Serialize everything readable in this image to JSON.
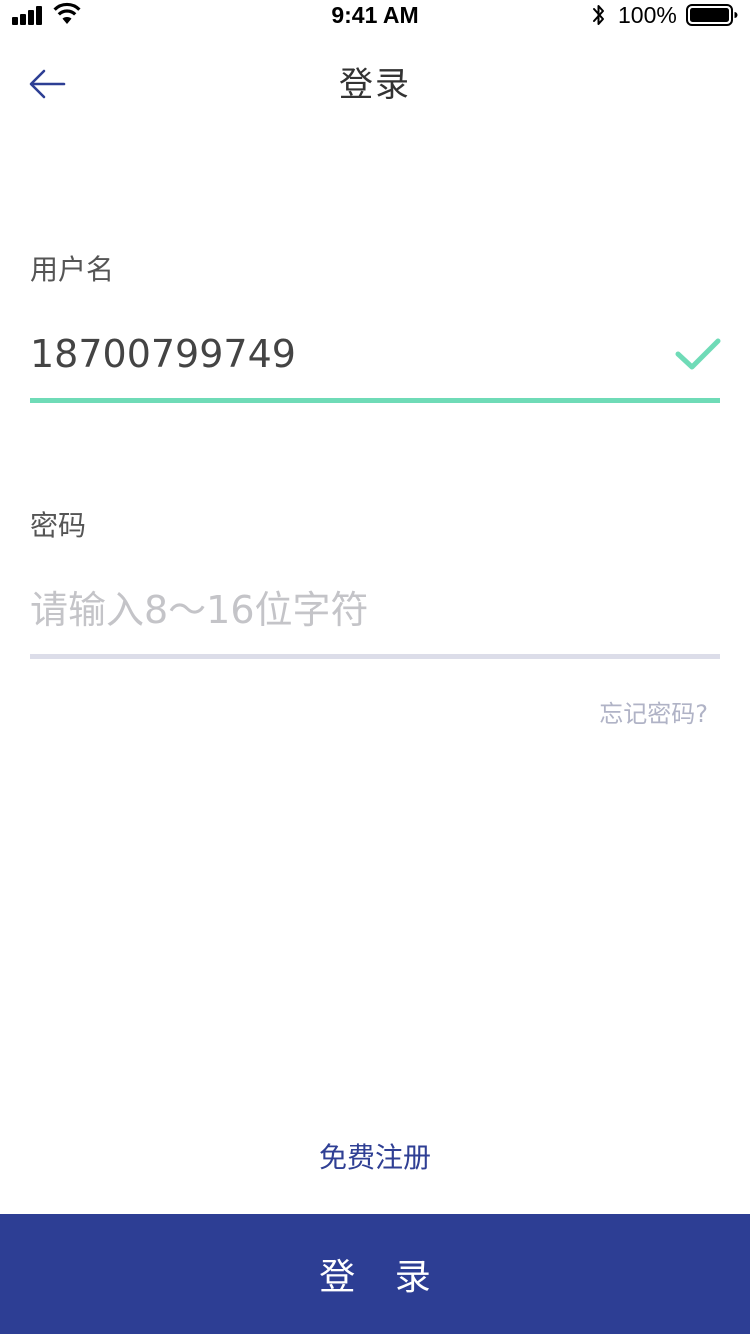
{
  "status_bar": {
    "time": "9:41 AM",
    "battery_percent": "100%",
    "icons": [
      "signal-icon",
      "wifi-icon",
      "bluetooth-icon",
      "battery-icon"
    ]
  },
  "nav": {
    "title": "登录",
    "back_icon": "arrow-left-icon"
  },
  "form": {
    "username": {
      "label": "用户名",
      "value": "18700799749",
      "valid_icon": "check-icon"
    },
    "password": {
      "label": "密码",
      "placeholder": "请输入8～16位字符",
      "value": ""
    },
    "forgot_password": "忘记密码?"
  },
  "register_link": "免费注册",
  "login_button": "登 录",
  "colors": {
    "primary": "#2d3e94",
    "valid": "#6fdbb7",
    "inactive_underline": "#dcdde9",
    "hint": "#b0b3c6"
  }
}
